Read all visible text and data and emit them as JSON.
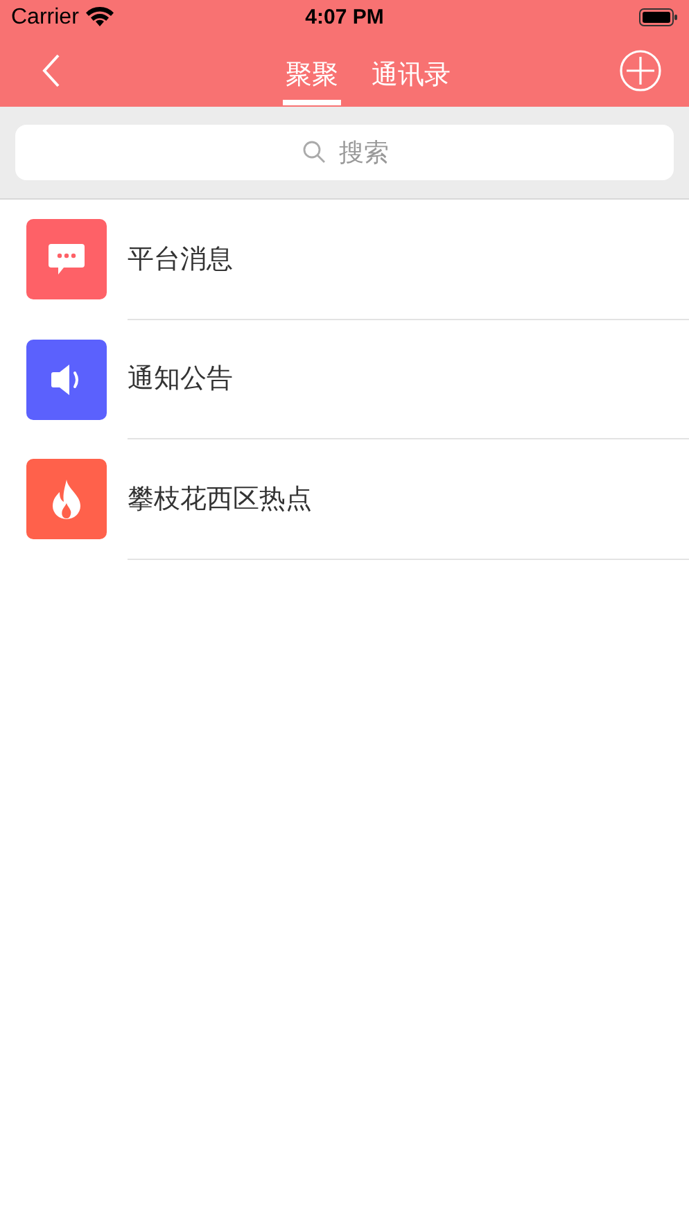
{
  "status_bar": {
    "carrier": "Carrier",
    "time": "4:07 PM"
  },
  "nav": {
    "tabs": [
      {
        "label": "聚聚",
        "selected": true
      },
      {
        "label": "通讯录",
        "selected": false
      }
    ]
  },
  "search": {
    "placeholder": "搜索"
  },
  "items": [
    {
      "kind": "chat",
      "color": "#fe6167",
      "label": "平台消息"
    },
    {
      "kind": "speaker",
      "color": "#5b61fd",
      "label": "通知公告"
    },
    {
      "kind": "flame",
      "color": "#ff614b",
      "label": "攀枝花西区热点"
    }
  ]
}
